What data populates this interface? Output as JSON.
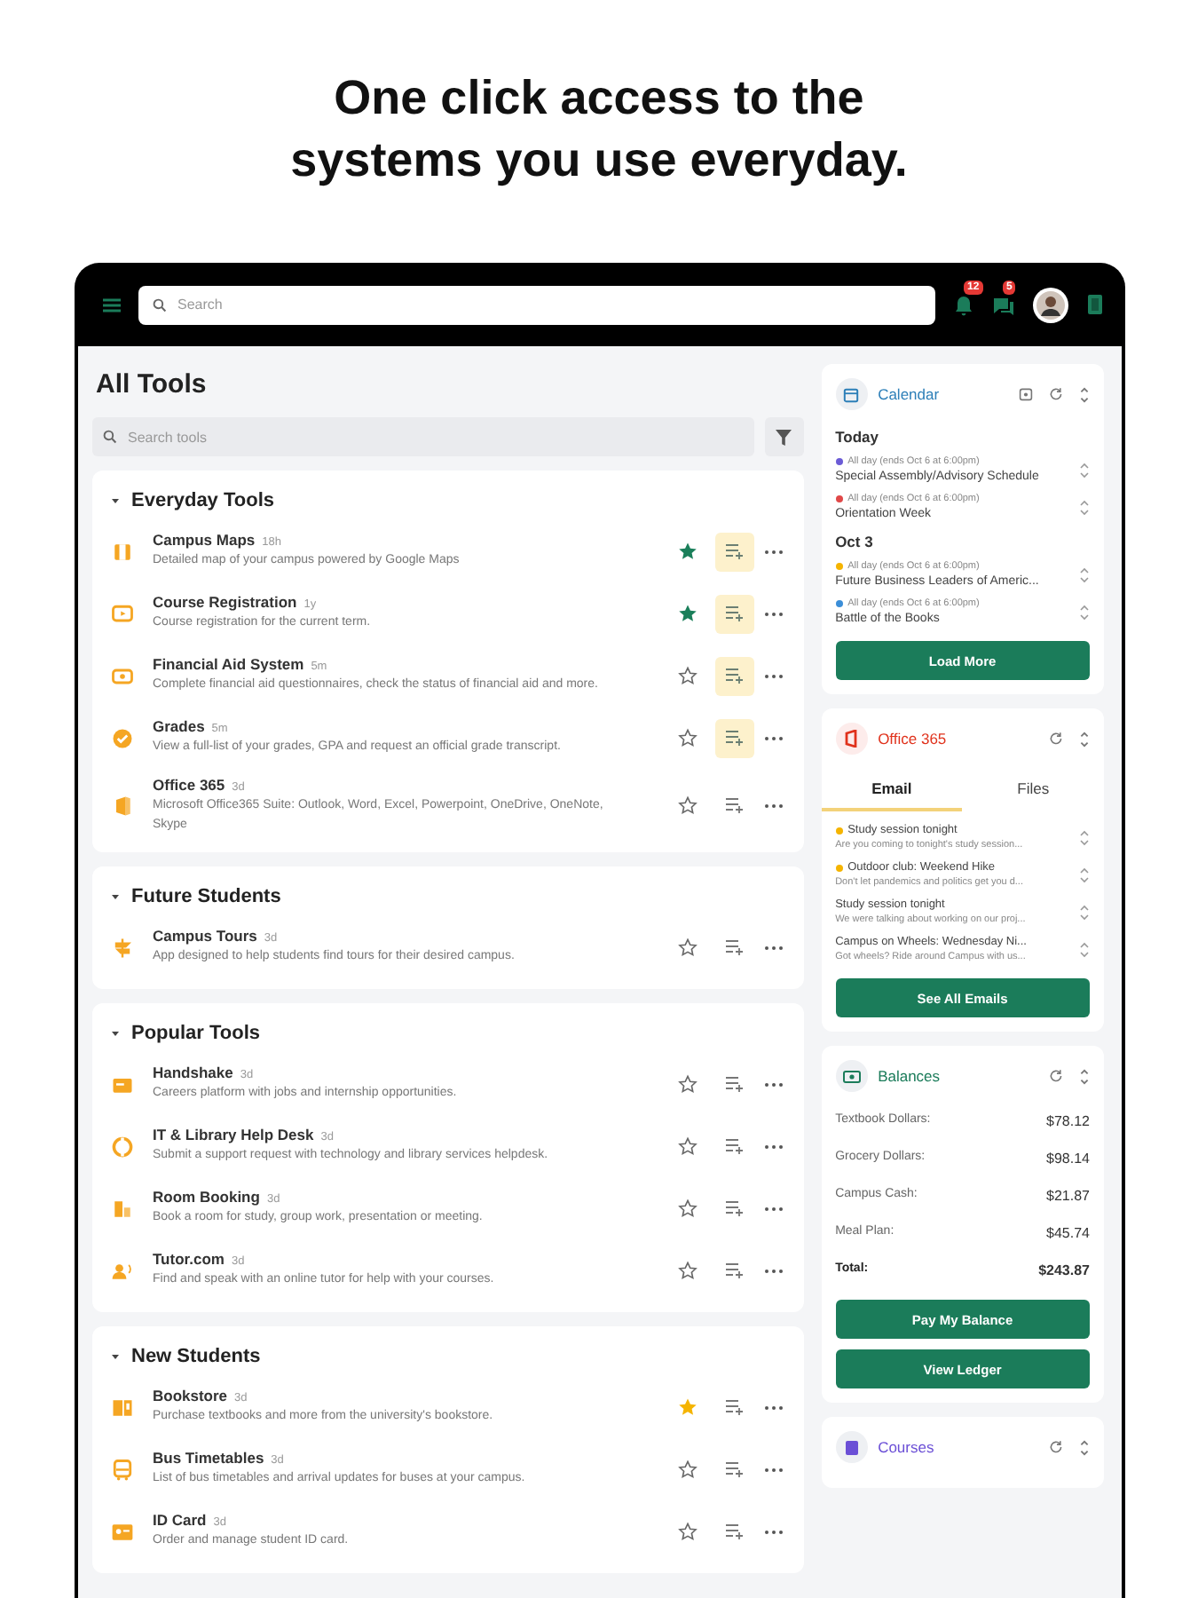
{
  "headline": [
    "One click access to the",
    "systems you use everyday."
  ],
  "topbar": {
    "search_placeholder": "Search",
    "notifications": {
      "badge": "12"
    },
    "messages": {
      "badge": "5"
    }
  },
  "all_tools": {
    "title": "All Tools",
    "search_placeholder": "Search tools",
    "sections": [
      {
        "title": "Everyday Tools",
        "expanded": true,
        "tools": [
          {
            "name": "Campus Maps",
            "age": "18h",
            "description": "Detailed map of your campus powered by Google Maps",
            "starred": true,
            "color": "#1a7f5a",
            "queued": true
          },
          {
            "name": "Course Registration",
            "age": "1y",
            "description": "Course registration for the current term.",
            "starred": true,
            "color": "#1a7f5a",
            "queued": true
          },
          {
            "name": "Financial Aid System",
            "age": "5m",
            "description": "Complete financial aid questionnaires, check the status of financial aid and more.",
            "starred": false,
            "queued": true
          },
          {
            "name": "Grades",
            "age": "5m",
            "description": "View a full-list of your grades, GPA and request an official grade transcript.",
            "starred": false,
            "queued": true
          },
          {
            "name": "Office 365",
            "age": "3d",
            "description": "Microsoft Office365 Suite: Outlook, Word, Excel, Powerpoint, OneDrive, OneNote, Skype",
            "starred": false,
            "queued": false
          }
        ]
      },
      {
        "title": "Future Students",
        "expanded": true,
        "tools": [
          {
            "name": "Campus Tours",
            "age": "3d",
            "description": "App designed to help students find tours for their desired campus.",
            "starred": false,
            "queued": false
          }
        ]
      },
      {
        "title": "Popular Tools",
        "expanded": true,
        "tools": [
          {
            "name": "Handshake",
            "age": "3d",
            "description": "Careers platform with jobs and internship opportunities.",
            "starred": false,
            "queued": false
          },
          {
            "name": "IT & Library Help Desk",
            "age": "3d",
            "description": "Submit a support request with technology and library services helpdesk.",
            "starred": false,
            "queued": false
          },
          {
            "name": "Room Booking",
            "age": "3d",
            "description": "Book a room for study, group work, presentation or meeting.",
            "starred": false,
            "queued": false
          },
          {
            "name": "Tutor.com",
            "age": "3d",
            "description": "Find and speak with an online tutor for help with your courses.",
            "starred": false,
            "queued": false
          }
        ]
      },
      {
        "title": "New Students",
        "expanded": true,
        "tools": [
          {
            "name": "Bookstore",
            "age": "3d",
            "description": "Purchase textbooks and more from the university's bookstore.",
            "starred": true,
            "color": "#f5b400",
            "queued": false
          },
          {
            "name": "Bus Timetables",
            "age": "3d",
            "description": "List of bus timetables and arrival updates for buses at your campus.",
            "starred": false,
            "queued": false
          },
          {
            "name": "ID Card",
            "age": "3d",
            "description": "Order and manage student ID card.",
            "starred": false,
            "queued": false
          }
        ]
      }
    ]
  },
  "calendar": {
    "title": "Calendar",
    "groups": [
      {
        "label": "Today",
        "events": [
          {
            "time": "All day (ends Oct 6 at 6:00pm)",
            "title": "Special Assembly/Advisory Schedule",
            "color": "#6b5bd6"
          },
          {
            "time": "All day (ends Oct 6 at 6:00pm)",
            "title": "Orientation Week",
            "color": "#e04848"
          }
        ]
      },
      {
        "label": "Oct 3",
        "events": [
          {
            "time": "All day (ends Oct 6 at 6:00pm)",
            "title": "Future Business Leaders of Americ...",
            "color": "#f5b400"
          },
          {
            "time": "All day (ends Oct 6 at 6:00pm)",
            "title": "Battle of the Books",
            "color": "#3b8ed8"
          }
        ]
      }
    ],
    "button": "Load More"
  },
  "office": {
    "title": "Office 365",
    "tabs": [
      {
        "label": "Email",
        "selected": true
      },
      {
        "label": "Files",
        "selected": false
      }
    ],
    "emails": [
      {
        "subject": "Study session tonight",
        "preview": "Are you coming to tonight's study session...",
        "unread": true
      },
      {
        "subject": "Outdoor club: Weekend Hike",
        "preview": "Don't let pandemics and politics get you d...",
        "unread": true
      },
      {
        "subject": "Study session tonight",
        "preview": "We were talking about working on our proj...",
        "unread": false
      },
      {
        "subject": "Campus on Wheels: Wednesday Ni...",
        "preview": "Got wheels? Ride around Campus with us...",
        "unread": false
      }
    ],
    "button": "See All Emails"
  },
  "balances": {
    "title": "Balances",
    "rows": [
      {
        "label": "Textbook Dollars:",
        "value": "$78.12",
        "kind": "item"
      },
      {
        "label": "Grocery Dollars:",
        "value": "$98.14",
        "kind": "item"
      },
      {
        "label": "Campus Cash:",
        "value": "$21.87",
        "kind": "item"
      },
      {
        "label": "Meal Plan:",
        "value": "$45.74",
        "kind": "item"
      },
      {
        "label": "Total:",
        "value": "$243.87",
        "kind": "total"
      }
    ],
    "buttons": [
      "Pay My Balance",
      "View Ledger"
    ]
  },
  "courses": {
    "title": "Courses"
  }
}
